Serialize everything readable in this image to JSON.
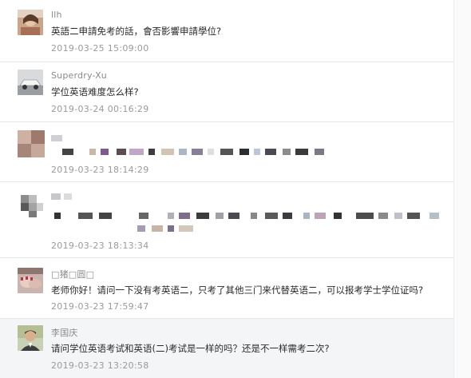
{
  "comments": [
    {
      "username": "llh",
      "content": "英語二申請免考的話，會否影響申請學位?",
      "timestamp": "2019-03-25 15:09:00",
      "avatar": "photo-avatar"
    },
    {
      "username": "Superdry-Xu",
      "content": "学位英语难度怎么样?",
      "timestamp": "2019-03-24 00:16:29",
      "avatar": "car-avatar"
    },
    {
      "username": "",
      "content": "",
      "timestamp": "2019-03-23 18:14:29",
      "avatar": "pixelated-avatar"
    },
    {
      "username": "",
      "content": "",
      "timestamp": "2019-03-23 18:13:34",
      "avatar": "pixelated-avatar"
    },
    {
      "username": "□猪□圆□",
      "content": "老师你好！请问一下没有考英语二，只考了其他三门来代替英语二，可以报考学士学位证吗?",
      "timestamp": "2019-03-23 17:59:47",
      "avatar": "hands-avatar"
    },
    {
      "username": "李国庆",
      "content": "请问学位英语考试和英语(二)考试是一样的吗？还是不一样需考二次?",
      "timestamp": "2019-03-23 13:20:58",
      "avatar": "person-avatar"
    }
  ],
  "colors": {
    "username": "#8a8a8a",
    "content": "#2a2a2a",
    "timestamp": "#9a9a9a",
    "divider": "#e6e6e6",
    "highlight_bg": "#f4f5f7"
  }
}
